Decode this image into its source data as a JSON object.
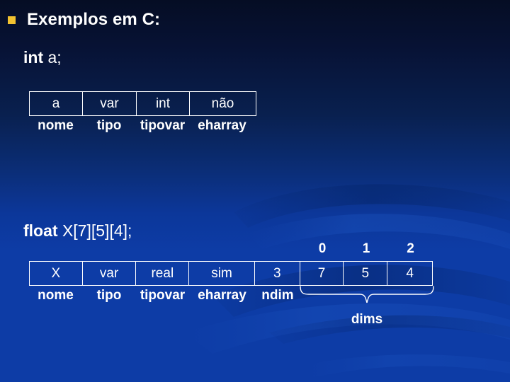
{
  "slide": {
    "title": "Exemplos em C:",
    "bullet_icon": "square-bullet-icon",
    "bullet_color": "#f2c230",
    "background": {
      "top_color": "#050d24",
      "bottom_color": "#0d3ca6"
    },
    "text_color": "#ffffff"
  },
  "example_int": {
    "declaration_keyword": "int",
    "declaration_expr": "a;",
    "cells": [
      "a",
      "var",
      "int",
      "não"
    ],
    "labels": [
      "nome",
      "tipo",
      "tipovar",
      "eharray"
    ]
  },
  "example_float": {
    "declaration_keyword": "float",
    "declaration_expr": "X[7][5][4];",
    "cells": [
      "X",
      "var",
      "real",
      "sim",
      "3",
      "7",
      "5",
      "4"
    ],
    "labels": [
      "nome",
      "tipo",
      "tipovar",
      "eharray",
      "ndim"
    ],
    "dim_indices": [
      "0",
      "1",
      "2"
    ],
    "dims_caption": "dims"
  }
}
